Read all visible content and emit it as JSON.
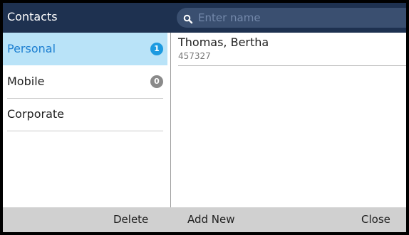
{
  "header": {
    "title": "Contacts",
    "search_placeholder": "Enter name"
  },
  "sidebar": {
    "items": [
      {
        "label": "Personal",
        "badge": "1",
        "selected": true
      },
      {
        "label": "Mobile",
        "badge": "0",
        "selected": false
      },
      {
        "label": "Corporate",
        "badge": "",
        "selected": false
      }
    ]
  },
  "contacts": [
    {
      "name": "Thomas, Bertha",
      "number": "457327"
    }
  ],
  "softkeys": {
    "delete": "Delete",
    "add_new": "Add New",
    "close": "Close"
  },
  "colors": {
    "header_bg": "#1e3150",
    "selected_bg": "#b9e3f8",
    "selected_text": "#1c7fd1",
    "badge_active": "#1c9ae0",
    "badge_inactive": "#8a8a8a",
    "footer_bg": "#d0d0d0"
  }
}
